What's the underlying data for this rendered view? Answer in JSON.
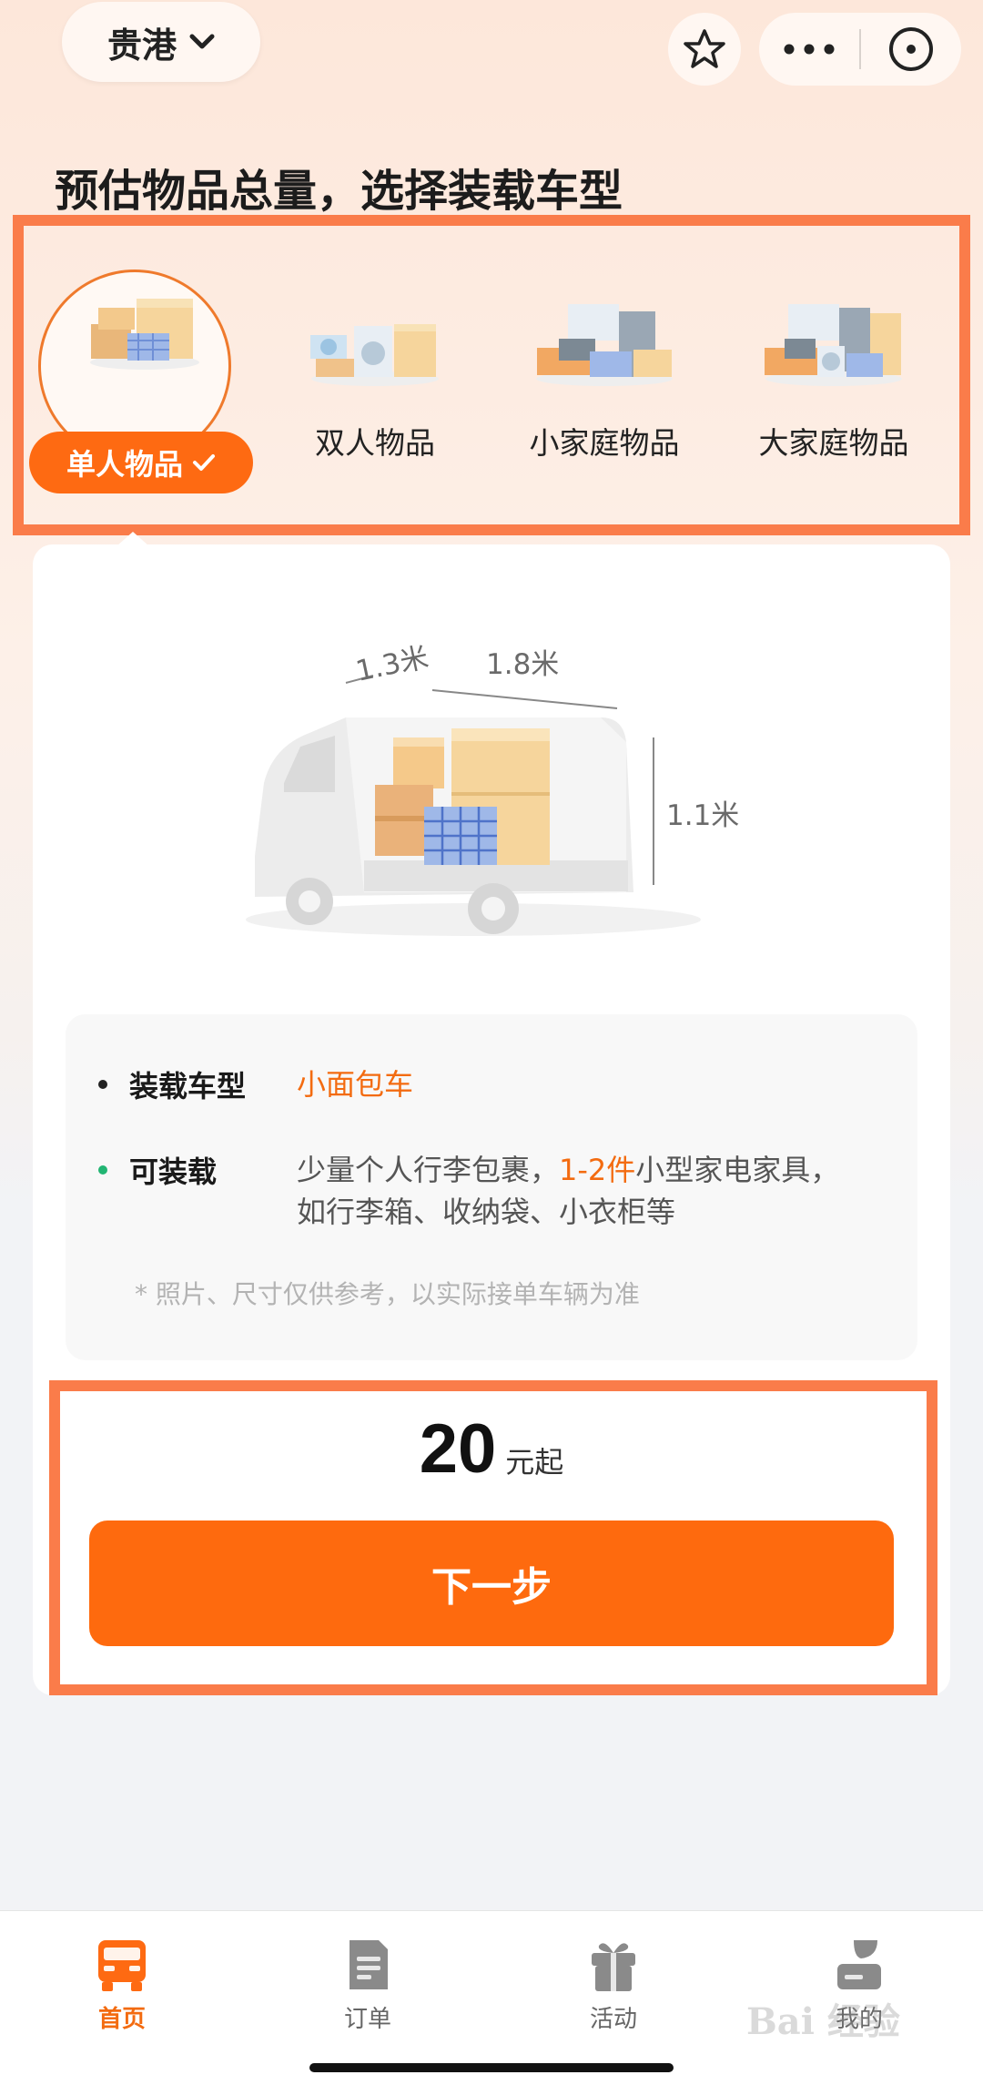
{
  "header": {
    "city": "贵港",
    "page_title": "预估物品总量，选择装载车型"
  },
  "categories": [
    {
      "label": "单人物品",
      "selected": true
    },
    {
      "label": "双人物品",
      "selected": false
    },
    {
      "label": "小家庭物品",
      "selected": false
    },
    {
      "label": "大家庭物品",
      "selected": false
    }
  ],
  "dimensions": {
    "width": "1.3米",
    "length": "1.8米",
    "height": "1.1米"
  },
  "vehicle_info": {
    "type_key": "装载车型",
    "type_value": "小面包车",
    "capacity_key": "可装载",
    "capacity_prefix": "少量个人行李包裹，",
    "capacity_highlight": "1-2件",
    "capacity_suffix": "小型家电家具，",
    "capacity_line2": "如行李箱、收纳袋、小衣柜等",
    "note": "* 照片、尺寸仅供参考，以实际接单车辆为准"
  },
  "price": {
    "amount": "20",
    "unit": "元起"
  },
  "next_button_label": "下一步",
  "tabbar": [
    {
      "label": "首页",
      "icon": "truck-icon",
      "active": true
    },
    {
      "label": "订单",
      "icon": "order-icon",
      "active": false
    },
    {
      "label": "活动",
      "icon": "gift-icon",
      "active": false
    },
    {
      "label": "我的",
      "icon": "user-icon",
      "active": false
    }
  ],
  "watermark": "Bai 经验",
  "colors": {
    "accent": "#fe6a0e",
    "highlight_frame": "#fa7c4a",
    "bullet_green": "#22b573"
  }
}
